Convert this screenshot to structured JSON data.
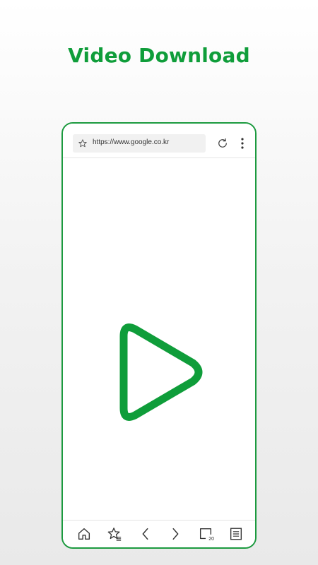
{
  "headline": "Video Download",
  "browser": {
    "url": "https://www.google.co.kr"
  },
  "icons": {
    "favorite": "star-icon",
    "reload": "reload-icon",
    "menu": "more-vert-icon",
    "logo": "play-logo-icon",
    "home": "home-icon",
    "bookmarks": "bookmark-list-icon",
    "back": "chevron-left-icon",
    "forward": "chevron-right-icon",
    "tabs": "tabs-icon",
    "list": "list-icon"
  },
  "bottom_nav": {
    "tab_count": "20"
  },
  "colors": {
    "brand_green": "#0f9d3a",
    "frame_green": "#1c9a3f"
  }
}
